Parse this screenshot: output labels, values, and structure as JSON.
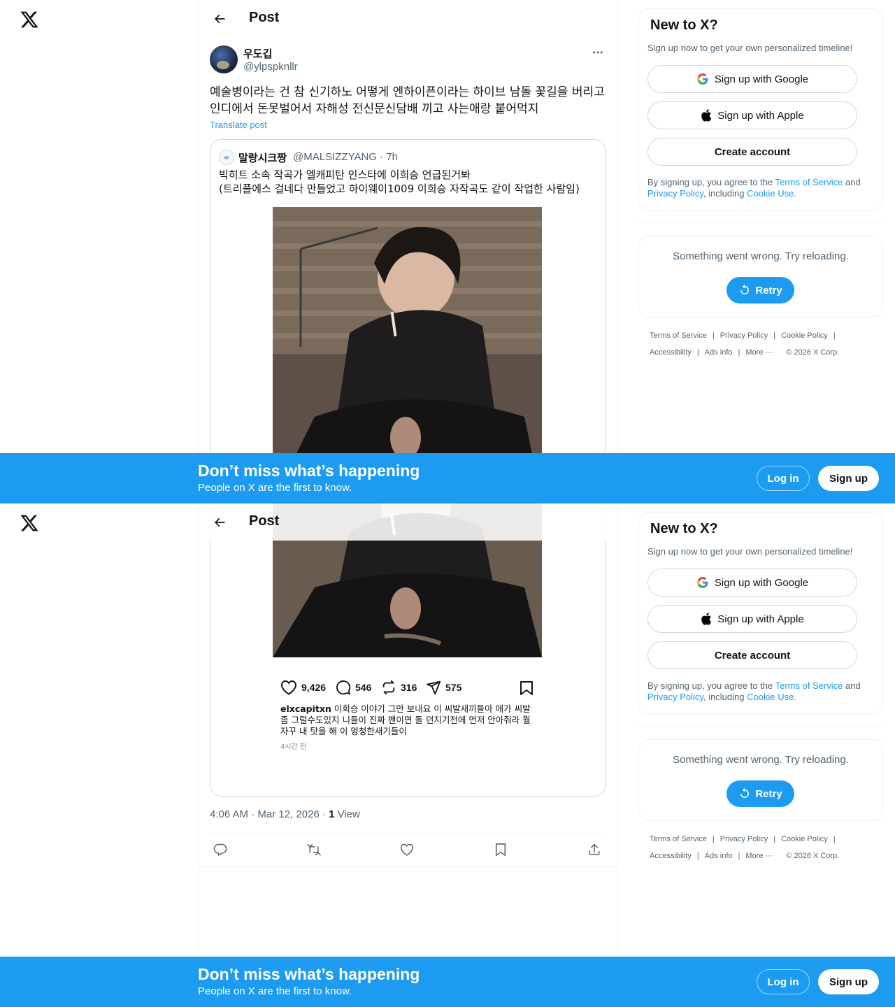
{
  "header": {
    "title": "Post"
  },
  "post": {
    "author_name": "우도깁",
    "author_handle": "@ylpspknllr",
    "text": "예술병이라는 건 참 신기하노 어떻게 엔하이픈이라는 하이브 남돌 꽃길을 버리고 인디에서 돈못벌어서 자해성 전신문신담배 끼고 사는애랑 붙어먹지",
    "translate_label": "Translate post",
    "timestamp": "4:06 AM · Mar 12, 2026 · ",
    "views_count": "1",
    "views_label": " View"
  },
  "quote": {
    "author_name": "말랑시크짱",
    "author_handle": "@MALSIZZYANG · 7h",
    "line1": "빅히트 소속 작곡가 엘캐피탄 인스타에 이희승 언급된거봐",
    "line2": "(트리플에스 걸네다 만들었고 하이웨이1009 이희승 자작곡도 같이 작업한 사람임)"
  },
  "instagram": {
    "likes": "9,426",
    "comments": "546",
    "reposts": "316",
    "shares": "575",
    "caption_user": "elxcapitxn",
    "caption_text": " 이희승 이야기 그만 보내요 이 씨발새끼들아 애가 씨발 좀 그럴수도있지 니들이 진짜 팬이면 돌 던지기전에 먼저 안아줘라 뭘 자꾸 내 탓을 해 이 멍청한새기들이",
    "time": "4시간 전"
  },
  "sidebar": {
    "title": "New to X?",
    "subtitle": "Sign up now to get your own personalized timeline!",
    "google_label": "Sign up with Google",
    "apple_label": "Sign up with Apple",
    "create_label": "Create account",
    "legal_prefix": "By signing up, you agree to the ",
    "terms_label": "Terms of Service",
    "and_label": " and ",
    "privacy_label": "Privacy Policy",
    "including_label": ", including ",
    "cookie_label": "Cookie Use.",
    "error_text": "Something went wrong. Try reloading.",
    "retry_label": "Retry"
  },
  "footer": {
    "terms": "Terms of Service",
    "privacy": "Privacy Policy",
    "cookie": "Cookie Policy",
    "accessibility": "Accessibility",
    "ads": "Ads info",
    "more": "More ···",
    "copyright": "© 2026 X Corp.",
    "sep": "|"
  },
  "banner": {
    "title": "Don’t miss what’s happening",
    "subtitle": "People on X are the first to know.",
    "login_label": "Log in",
    "signup_label": "Sign up"
  },
  "colors": {
    "accent": "#1d9bf0",
    "text": "#0f1419",
    "muted": "#536471",
    "border": "#cfd9de"
  },
  "icons": [
    "x-logo-icon",
    "back-arrow-icon",
    "more-icon",
    "google-icon",
    "apple-icon",
    "retry-icon",
    "reply-icon",
    "repost-icon",
    "like-icon",
    "bookmark-icon",
    "share-icon"
  ]
}
